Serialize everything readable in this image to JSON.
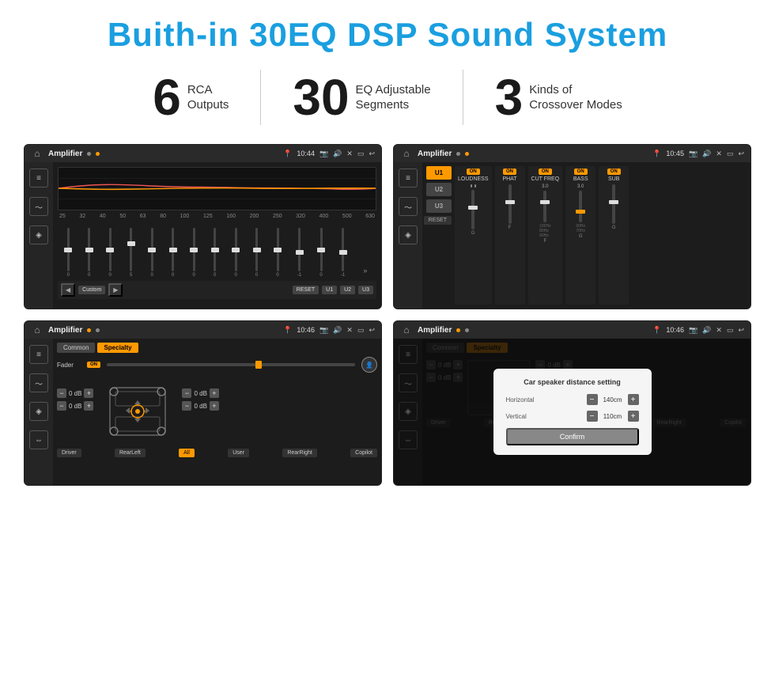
{
  "page": {
    "title": "Buith-in 30EQ DSP Sound System",
    "stats": [
      {
        "number": "6",
        "text_line1": "RCA",
        "text_line2": "Outputs"
      },
      {
        "number": "30",
        "text_line1": "EQ Adjustable",
        "text_line2": "Segments"
      },
      {
        "number": "3",
        "text_line1": "Kinds of",
        "text_line2": "Crossover Modes"
      }
    ]
  },
  "screens": {
    "screen1": {
      "title": "Amplifier",
      "time": "10:44",
      "freq_labels": [
        "25",
        "32",
        "40",
        "50",
        "63",
        "80",
        "100",
        "125",
        "160",
        "200",
        "250",
        "320",
        "400",
        "500",
        "630"
      ],
      "slider_vals": [
        "0",
        "0",
        "0",
        "5",
        "0",
        "0",
        "0",
        "0",
        "0",
        "0",
        "0",
        "-1",
        "0",
        "-1"
      ],
      "buttons": [
        "Custom",
        "RESET",
        "U1",
        "U2",
        "U3"
      ]
    },
    "screen2": {
      "title": "Amplifier",
      "time": "10:45",
      "u_buttons": [
        "U1",
        "U2",
        "U3"
      ],
      "controls": [
        "LOUDNESS",
        "PHAT",
        "CUT FREQ",
        "BASS",
        "SUB"
      ],
      "reset": "RESET"
    },
    "screen3": {
      "title": "Amplifier",
      "time": "10:46",
      "tabs": [
        "Common",
        "Specialty"
      ],
      "fader_label": "Fader",
      "fader_on": "ON",
      "db_values": [
        "0 dB",
        "0 dB",
        "0 dB",
        "0 dB"
      ],
      "bottom_buttons": [
        "Driver",
        "RearLeft",
        "All",
        "User",
        "RearRight",
        "Copilot"
      ]
    },
    "screen4": {
      "title": "Amplifier",
      "time": "10:46",
      "tabs": [
        "Common",
        "Specialty"
      ],
      "dialog_title": "Car speaker distance setting",
      "horizontal_label": "Horizontal",
      "horizontal_value": "140cm",
      "vertical_label": "Vertical",
      "vertical_value": "110cm",
      "confirm_label": "Confirm",
      "db_values": [
        "0 dB",
        "0 dB"
      ],
      "bottom_buttons": [
        "Driver",
        "RearLeft",
        "All",
        "User",
        "RearRight",
        "Copilot"
      ]
    }
  },
  "icons": {
    "home": "⌂",
    "back": "↩",
    "settings": "⚙",
    "location": "📍",
    "camera": "📷",
    "sound": "🔊",
    "close": "✕",
    "window": "▭",
    "eq_icon": "≡",
    "wave_icon": "〜",
    "speaker_icon": "◈",
    "arrows_icon": "⇔"
  }
}
